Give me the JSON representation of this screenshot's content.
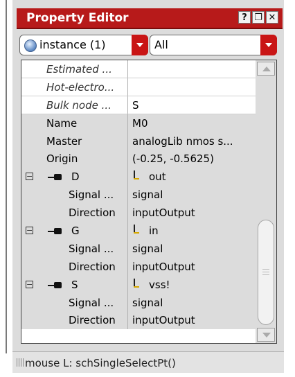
{
  "window": {
    "title": "Property Editor",
    "buttons": [
      {
        "label": "?",
        "icon": "help-icon"
      },
      {
        "label": "❐",
        "icon": "restore-icon"
      },
      {
        "label": "✕",
        "icon": "close-icon"
      }
    ]
  },
  "toolbar": {
    "selection_combo": "instance (1)",
    "filter_combo": "All"
  },
  "properties": [
    {
      "name": "Estimated ...",
      "value": "",
      "indent": 1,
      "italic": true
    },
    {
      "name": "Hot-electro...",
      "value": "",
      "indent": 1,
      "italic": true
    },
    {
      "name": "Bulk node ...",
      "value": "S",
      "indent": 1,
      "italic": true
    },
    {
      "name": "Name",
      "value": "M0",
      "indent": 1
    },
    {
      "name": "Master",
      "value": "analogLib nmos s...",
      "indent": 1
    },
    {
      "name": "Origin",
      "value": "(-0.25, -0.5625)",
      "indent": 1
    },
    {
      "name": "D",
      "value": "out",
      "terminal": true
    },
    {
      "name": "Signal ...",
      "value": "signal",
      "indent": 2
    },
    {
      "name": "Direction",
      "value": "inputOutput",
      "indent": 2
    },
    {
      "name": "G",
      "value": "in",
      "terminal": true
    },
    {
      "name": "Signal ...",
      "value": "signal",
      "indent": 2
    },
    {
      "name": "Direction",
      "value": "inputOutput",
      "indent": 2
    },
    {
      "name": "S",
      "value": "vss!",
      "terminal": true
    },
    {
      "name": "Signal ...",
      "value": "signal",
      "indent": 2
    },
    {
      "name": "Direction",
      "value": "inputOutput",
      "indent": 2
    }
  ],
  "status": {
    "text": "mouse L: schSingleSelectPt()"
  },
  "colors": {
    "titlebar": "#b71a1a",
    "accent": "#c91515"
  }
}
